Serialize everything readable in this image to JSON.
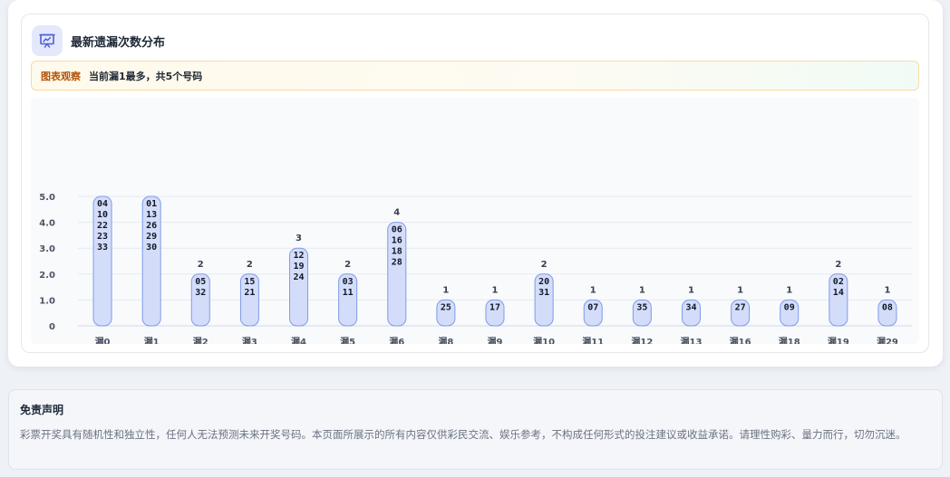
{
  "section": {
    "title": "最新遗漏次数分布",
    "insight_tag": "图表观察",
    "insight_text": "当前漏1最多，共5个号码"
  },
  "colors": {
    "bar_fill": "#d3ddfa",
    "bar_stroke": "#7f9aea",
    "header_icon": "#4f5fd6",
    "insight_tag": "#b45309"
  },
  "icons": {
    "header": "chart-presentation-icon"
  },
  "chart_data": {
    "type": "bar",
    "categories": [
      "漏0",
      "漏1",
      "漏2",
      "漏3",
      "漏4",
      "漏5",
      "漏6",
      "漏8",
      "漏9",
      "漏10",
      "漏11",
      "漏12",
      "漏13",
      "漏16",
      "漏18",
      "漏19",
      "漏29"
    ],
    "values": [
      5,
      5,
      2,
      2,
      3,
      2,
      4,
      1,
      1,
      2,
      1,
      1,
      1,
      1,
      1,
      2,
      1
    ],
    "numbers": [
      [
        "04",
        "10",
        "22",
        "23",
        "33"
      ],
      [
        "01",
        "13",
        "26",
        "29",
        "30"
      ],
      [
        "05",
        "32"
      ],
      [
        "15",
        "21"
      ],
      [
        "12",
        "19",
        "24"
      ],
      [
        "03",
        "11"
      ],
      [
        "06",
        "16",
        "18",
        "28"
      ],
      [
        "25"
      ],
      [
        "17"
      ],
      [
        "20",
        "31"
      ],
      [
        "07"
      ],
      [
        "35"
      ],
      [
        "34"
      ],
      [
        "27"
      ],
      [
        "09"
      ],
      [
        "02",
        "14"
      ],
      [
        "08"
      ]
    ],
    "value_labels": [
      "",
      "",
      "2",
      "2",
      "3",
      "2",
      "4",
      "1",
      "1",
      "2",
      "1",
      "1",
      "1",
      "1",
      "1",
      "2",
      "1"
    ],
    "yticks": [
      "0",
      "1.0",
      "2.0",
      "3.0",
      "4.0",
      "5.0"
    ],
    "ylim": [
      0,
      5
    ],
    "grid": true,
    "xlabel": "",
    "ylabel": ""
  },
  "disclaimer": {
    "title": "免责声明",
    "text": "彩票开奖具有随机性和独立性，任何人无法预测未来开奖号码。本页面所展示的所有内容仅供彩民交流、娱乐参考，不构成任何形式的投注建议或收益承诺。请理性购彩、量力而行，切勿沉迷。"
  }
}
